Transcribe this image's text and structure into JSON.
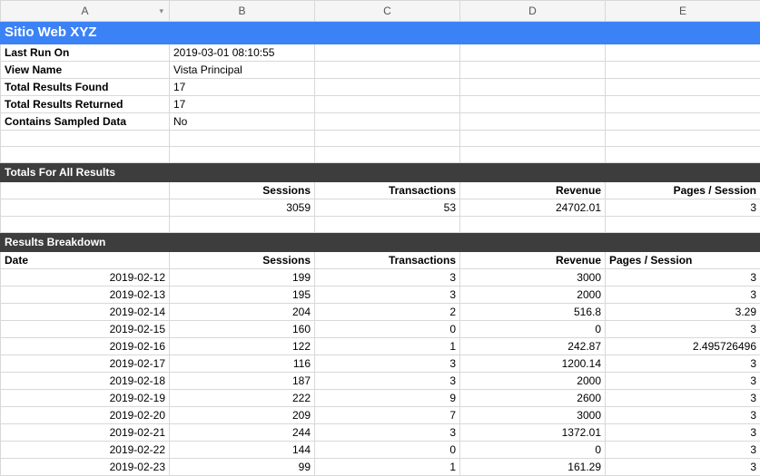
{
  "columns": [
    "A",
    "B",
    "C",
    "D",
    "E"
  ],
  "title": "Sitio Web XYZ",
  "meta": [
    {
      "label": "Last Run On",
      "value": "2019-03-01 08:10:55"
    },
    {
      "label": "View Name",
      "value": "Vista Principal"
    },
    {
      "label": "Total Results Found",
      "value": "17"
    },
    {
      "label": "Total Results Returned",
      "value": "17"
    },
    {
      "label": "Contains Sampled Data",
      "value": "No"
    }
  ],
  "totals_section_label": "Totals For All Results",
  "totals_headers": [
    "Sessions",
    "Transactions",
    "Revenue",
    "Pages / Session"
  ],
  "totals_values": [
    "3059",
    "53",
    "24702.01",
    "3"
  ],
  "breakdown_section_label": "Results Breakdown",
  "breakdown_headers": {
    "date": "Date",
    "sessions": "Sessions",
    "transactions": "Transactions",
    "revenue": "Revenue",
    "pps": "Pages / Session"
  },
  "chart_data": {
    "type": "table",
    "columns": [
      "Date",
      "Sessions",
      "Transactions",
      "Revenue",
      "Pages / Session"
    ],
    "rows": [
      [
        "2019-02-12",
        199,
        3,
        3000,
        3
      ],
      [
        "2019-02-13",
        195,
        3,
        2000,
        3
      ],
      [
        "2019-02-14",
        204,
        2,
        516.8,
        3.29
      ],
      [
        "2019-02-15",
        160,
        0,
        0,
        3
      ],
      [
        "2019-02-16",
        122,
        1,
        242.87,
        2.495726496
      ],
      [
        "2019-02-17",
        116,
        3,
        1200.14,
        3
      ],
      [
        "2019-02-18",
        187,
        3,
        2000,
        3
      ],
      [
        "2019-02-19",
        222,
        9,
        2600,
        3
      ],
      [
        "2019-02-20",
        209,
        7,
        3000,
        3
      ],
      [
        "2019-02-21",
        244,
        3,
        1372.01,
        3
      ],
      [
        "2019-02-22",
        144,
        0,
        0,
        3
      ],
      [
        "2019-02-23",
        99,
        1,
        161.29,
        3
      ]
    ]
  }
}
